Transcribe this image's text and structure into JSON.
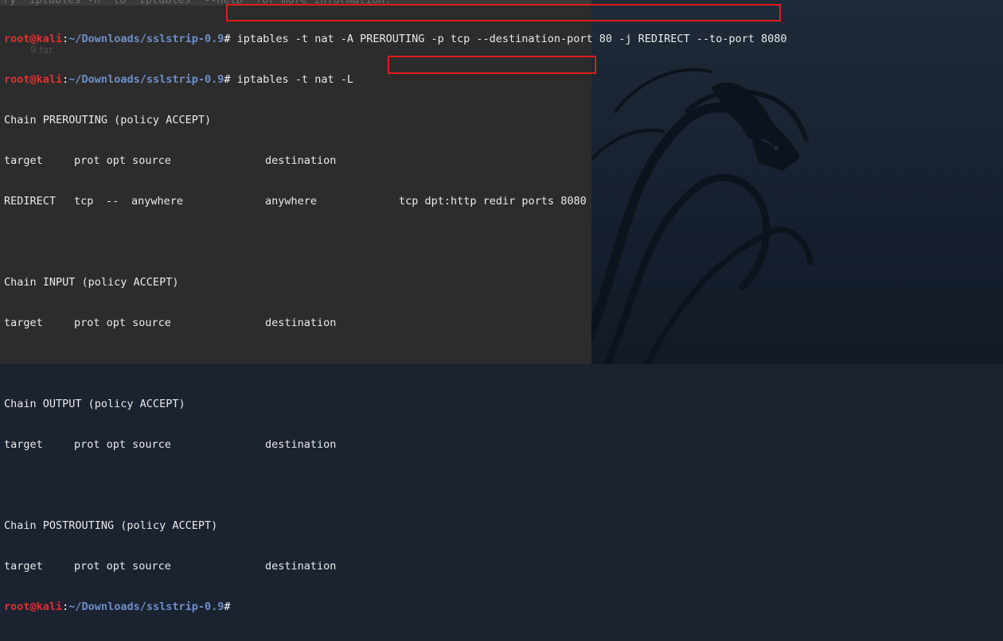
{
  "prompt": {
    "user": "root@kali",
    "sep": ":",
    "path": "~/Downloads/sslstrip-0.9",
    "hash": "#"
  },
  "faint_previous_line": "ry  iptables -h  to  iptables  --help  for more information.",
  "ghost_desktop_label": "9.tar.",
  "commands": [
    "iptables -t nat -A PREROUTING -p tcp --destination-port 80 -j REDIRECT --to-port 8080",
    "iptables -t nat -L"
  ],
  "output": {
    "prerouting_title": "Chain PREROUTING (policy ACCEPT)",
    "header": {
      "target": "target",
      "prot_opt_source": "prot opt source",
      "destination": "destination"
    },
    "redirect_row": {
      "target": "REDIRECT",
      "prot": "tcp",
      "opt": "--",
      "source": "anywhere",
      "destination": "anywhere",
      "extra": "tcp dpt:http redir ports 8080"
    },
    "input_title": "Chain INPUT (policy ACCEPT)",
    "output_title": "Chain OUTPUT (policy ACCEPT)",
    "postrouting_title": "Chain POSTROUTING (policy ACCEPT)"
  },
  "colors": {
    "terminal_bg": "#2c2c2c",
    "prompt_user": "#e0302f",
    "prompt_path": "#6e8fc9",
    "highlight_box": "#e01b1b",
    "wallpaper": "#1b2230"
  }
}
